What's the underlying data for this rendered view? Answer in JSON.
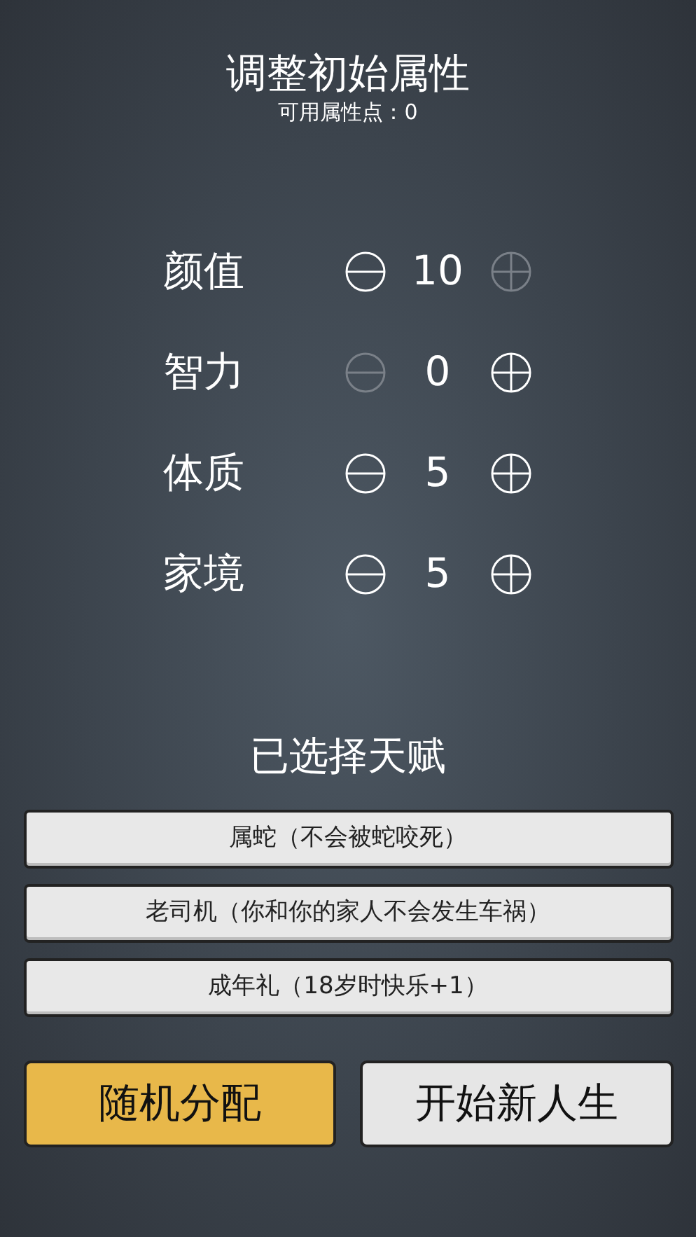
{
  "title": "调整初始属性",
  "points": "可用属性点：0",
  "attributes": [
    {
      "label": "颜值",
      "value": "10",
      "minus_disabled": false,
      "plus_disabled": true
    },
    {
      "label": "智力",
      "value": "0",
      "minus_disabled": true,
      "plus_disabled": false
    },
    {
      "label": "体质",
      "value": "5",
      "minus_disabled": false,
      "plus_disabled": false
    },
    {
      "label": "家境",
      "value": "5",
      "minus_disabled": false,
      "plus_disabled": false
    }
  ],
  "talents_heading": "已选择天赋",
  "talents": [
    "属蛇（不会被蛇咬死）",
    "老司机（你和你的家人不会发生车祸）",
    "成年礼（18岁时快乐+1）"
  ],
  "buttons": [
    {
      "label": "随机分配",
      "kind": "primary"
    },
    {
      "label": "开始新人生",
      "kind": "secondary"
    }
  ]
}
